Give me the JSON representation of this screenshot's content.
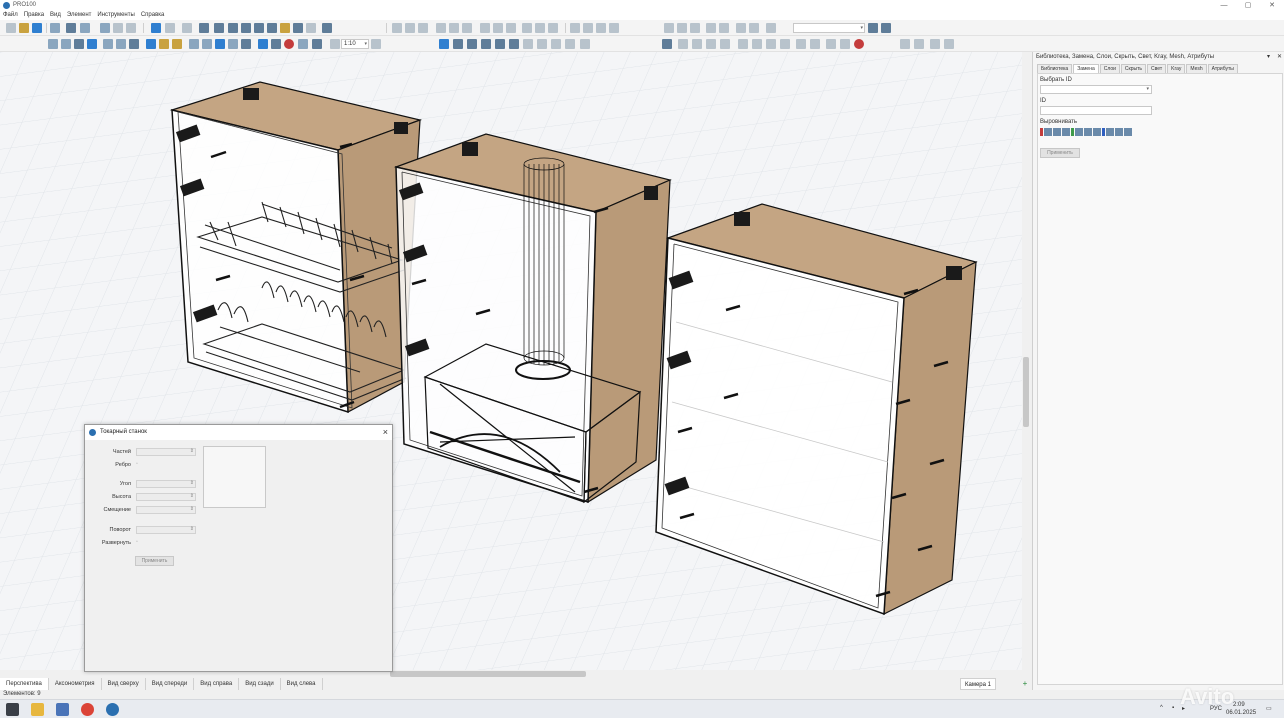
{
  "app": {
    "title": "PRO100",
    "window_controls": {
      "minimize": "—",
      "maximize": "▢",
      "close": "✕"
    }
  },
  "menu": [
    "Файл",
    "Правка",
    "Вид",
    "Элемент",
    "Инструменты",
    "Справка"
  ],
  "toolbar": {
    "zoom_value": "1:10",
    "accent_color": "#2f7fd0"
  },
  "viewport": {
    "background": "#f4f5f7",
    "grid_color": "#dfe3e8",
    "wood_color": "#b99a78",
    "line_color": "#111111"
  },
  "view_tabs": [
    "Перспектива",
    "Аксонометрия",
    "Вид сверху",
    "Вид спереди",
    "Вид справа",
    "Вид сзади",
    "Вид слева"
  ],
  "active_view_tab": "Перспектива",
  "camera_tab": "Камера 1",
  "status": {
    "elements": "Элементов: 9"
  },
  "taskbar": {
    "lang": "РУС",
    "time": "2:09",
    "date": "06.01.2025"
  },
  "right_panel": {
    "title": "Библиотека, Замена, Слои, Скрыть, Свет, Kray, Mesh, Атрибуты",
    "tabs": [
      "Библиотека",
      "Замена",
      "Слои",
      "Скрыть",
      "Свет",
      "Kray",
      "Mesh",
      "Атрибуты"
    ],
    "active_tab": "Замена",
    "select_id_label": "Выбрать ID",
    "id_label": "ID",
    "align_label": "Выровнивать",
    "apply_button": "Применить"
  },
  "lathe_dialog": {
    "title": "Токарный станок",
    "fields": {
      "parts": "Частей",
      "edge": "Ребро",
      "angle": "Угол",
      "height": "Высота",
      "offset": "Смещение",
      "rotate": "Поворот",
      "unfold": "Развернуть"
    },
    "apply_button": "Применить"
  },
  "watermark": "Avito"
}
